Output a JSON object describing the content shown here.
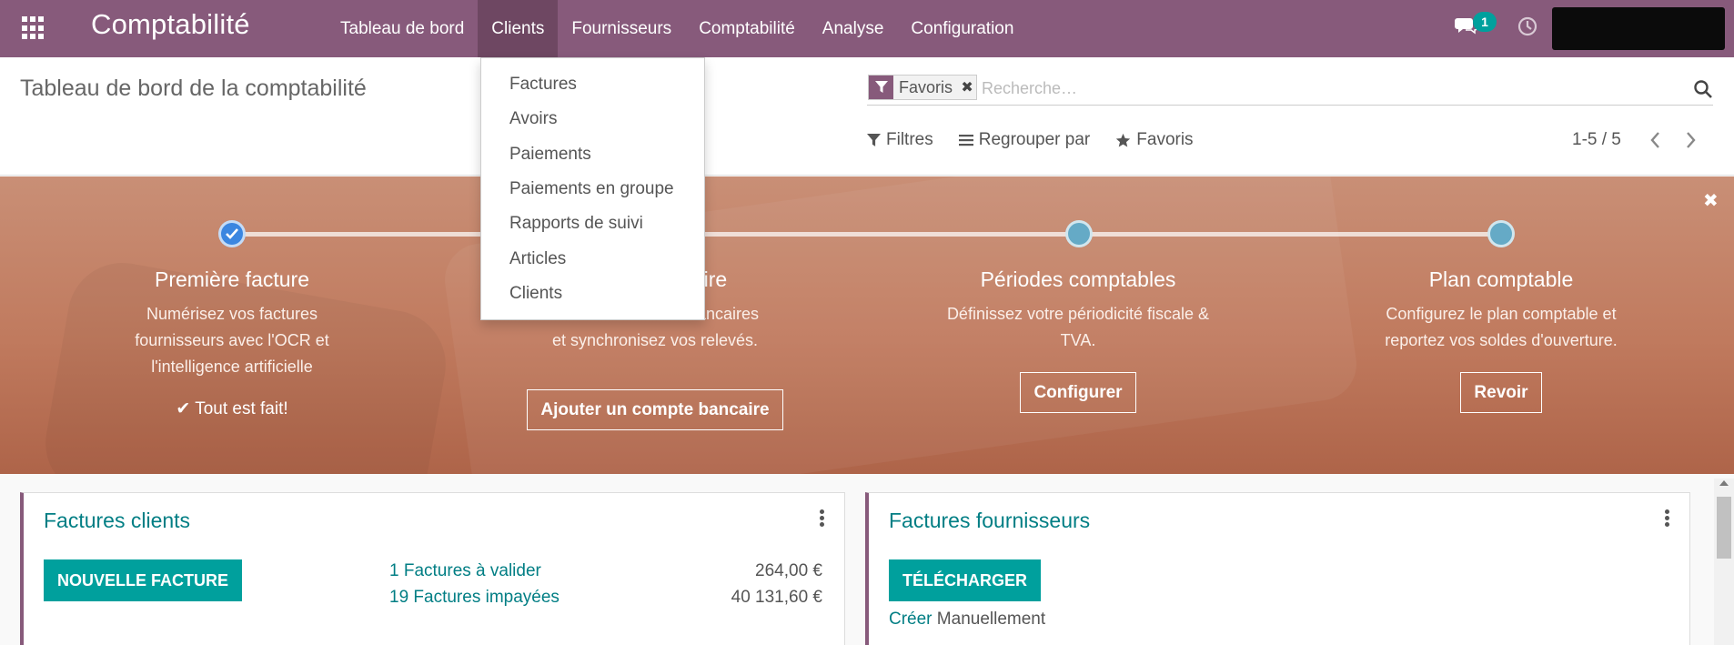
{
  "app": {
    "title": "Comptabilité",
    "menu": [
      "Tableau de bord",
      "Clients",
      "Fournisseurs",
      "Comptabilité",
      "Analyse",
      "Configuration"
    ],
    "active_menu": "Clients",
    "chat_count": "1",
    "icons": {
      "apps": "apps-grid-icon",
      "chat": "chat-bubble-icon",
      "activity": "clock-icon"
    }
  },
  "control_panel": {
    "breadcrumb": "Tableau de bord de la comptabilité",
    "facet": "Favoris",
    "search_placeholder": "Recherche…",
    "filters": "Filtres",
    "group_by": "Regrouper par",
    "favorites": "Favoris",
    "pager": "1-5 / 5"
  },
  "dropdown": {
    "items": [
      "Factures",
      "Avoirs",
      "Paiements",
      "Paiements en groupe",
      "Rapports de suivi",
      "Articles",
      "Clients"
    ]
  },
  "onboarding": {
    "steps": [
      {
        "title": "Première facture",
        "desc": [
          "Numérisez vos factures",
          "fournisseurs avec l'OCR et",
          "l'intelligence artificielle"
        ],
        "done": "Tout est fait!",
        "status": "done"
      },
      {
        "title": "aire",
        "desc": [
          "bancaires",
          "et synchronisez vos relevés."
        ],
        "button": "Ajouter un compte bancaire",
        "status": "todo"
      },
      {
        "title": "Périodes comptables",
        "desc": [
          "Définissez votre périodicité fiscale &",
          "TVA."
        ],
        "button": "Configurer",
        "status": "todo"
      },
      {
        "title": "Plan comptable",
        "desc": [
          "Configurez le plan comptable et",
          "reportez vos soldes d'ouverture."
        ],
        "button": "Revoir",
        "status": "todo"
      }
    ],
    "colors": {
      "banner": "#c07a5e",
      "dot": "#65aac6",
      "done_dot": "#3b86e0"
    }
  },
  "cards": {
    "customers": {
      "title": "Factures clients",
      "button": "NOUVELLE FACTURE",
      "rows": [
        {
          "label": "1 Factures à valider",
          "amount": "264,00 €"
        },
        {
          "label": "19 Factures impayées",
          "amount": "40 131,60 €"
        }
      ]
    },
    "suppliers": {
      "title": "Factures fournisseurs",
      "button": "TÉLÉCHARGER",
      "create_link": "Créer",
      "create_text": "Manuellement"
    }
  },
  "colors": {
    "brand": "#875a7b",
    "accent": "#00a09d",
    "link": "#017e84"
  }
}
